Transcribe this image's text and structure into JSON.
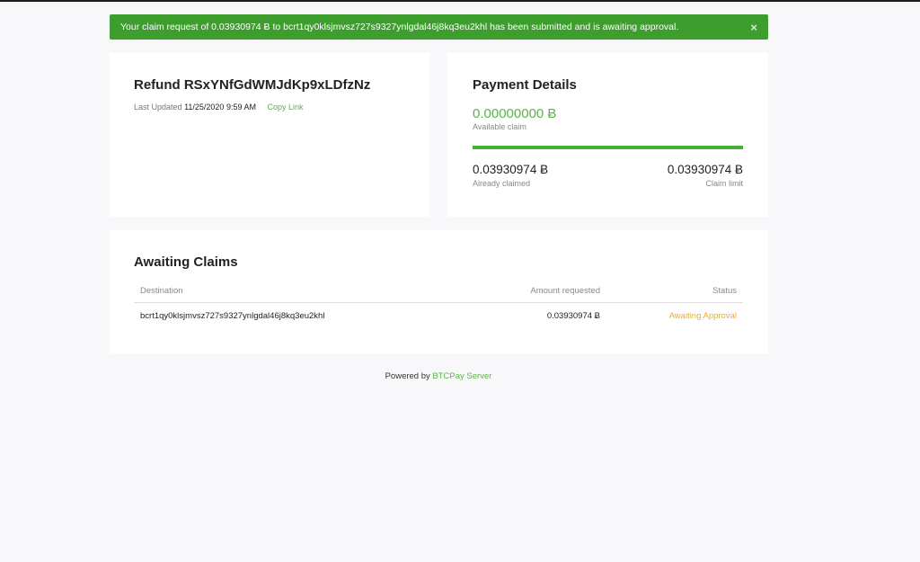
{
  "alert": {
    "message": "Your claim request of 0.03930974 Ƀ to bcrt1qy0klsjmvsz727s9327ynlgdal46j8kq3eu2khl has been submitted and is awaiting approval.",
    "close_glyph": "×",
    "color": "#3d9e2d"
  },
  "refund": {
    "title": "Refund RSxYNfGdWMJdKp9xLDfzNz",
    "last_updated_label": "Last Updated",
    "last_updated_value": "11/25/2020 9:59 AM",
    "copy_link_label": "Copy Link"
  },
  "payment": {
    "title": "Payment Details",
    "available_amount": "0.00000000 Ƀ",
    "available_label": "Available claim",
    "claimed_fraction": 1.0,
    "already_claimed_amount": "0.03930974 Ƀ",
    "already_claimed_label": "Already claimed",
    "claim_limit_amount": "0.03930974 Ƀ",
    "claim_limit_label": "Claim limit",
    "accent_color": "#5db249"
  },
  "claims": {
    "title": "Awaiting Claims",
    "headers": {
      "destination": "Destination",
      "amount": "Amount requested",
      "status": "Status"
    },
    "rows": [
      {
        "destination": "bcrt1qy0klsjmvsz727s9327ynlgdal46j8kq3eu2khl",
        "amount": "0.03930974 Ƀ",
        "status": "Awaiting Approval"
      }
    ],
    "status_color": "#f0ad1f"
  },
  "footer": {
    "powered_by": "Powered by",
    "brand": "BTCPay Server"
  }
}
